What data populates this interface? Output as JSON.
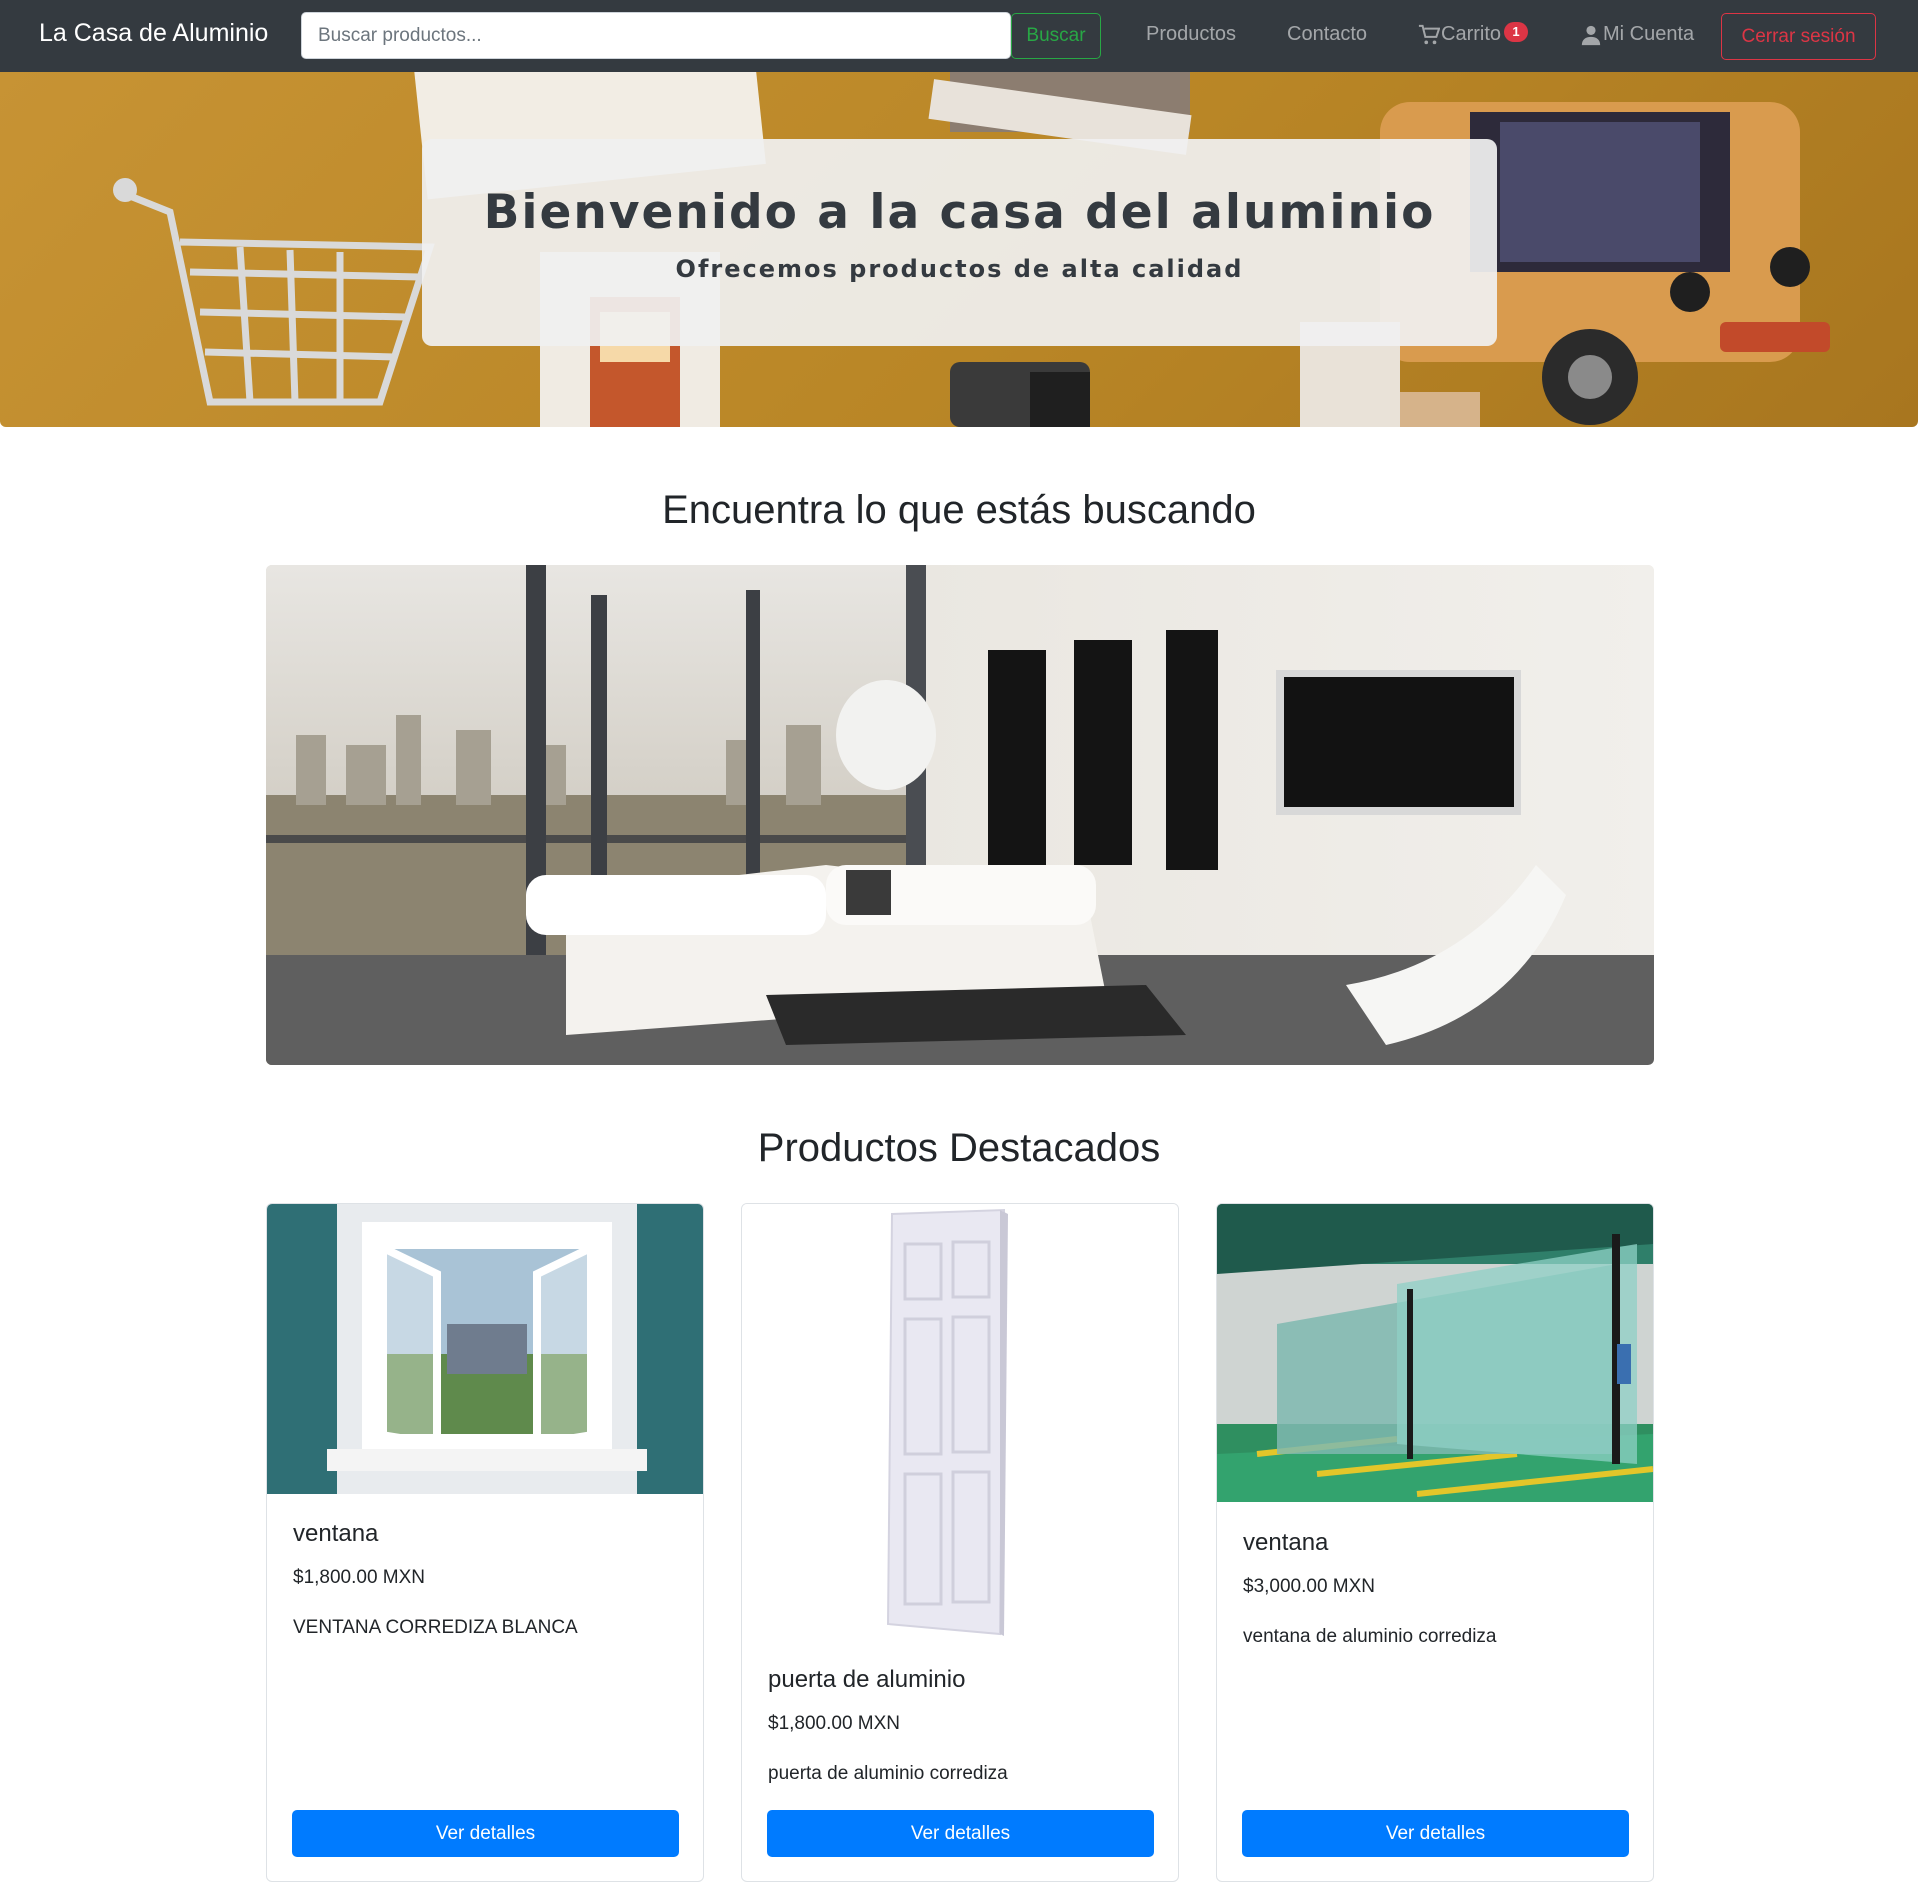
{
  "navbar": {
    "brand": "La Casa de Aluminio",
    "search_placeholder": "Buscar productos...",
    "search_button": "Buscar",
    "links": {
      "products": "Productos",
      "contact": "Contacto",
      "cart": "Carrito",
      "cart_count": "1",
      "account": "Mi Cuenta"
    },
    "logout_button": "Cerrar sesión",
    "icons": {
      "cart": "cart-icon",
      "account": "user-icon"
    }
  },
  "hero": {
    "title": "Bienvenido a la casa del aluminio",
    "subtitle": "Ofrecemos productos de alta calidad"
  },
  "find_section": {
    "title": "Encuentra lo que estás buscando"
  },
  "featured": {
    "title": "Productos Destacados",
    "products": [
      {
        "name": "ventana",
        "price": "$1,800.00 MXN",
        "description": "VENTANA CORREDIZA BLANCA",
        "button": "Ver detalles"
      },
      {
        "name": "puerta de aluminio",
        "price": "$1,800.00 MXN",
        "description": "puerta de aluminio corrediza",
        "button": "Ver detalles"
      },
      {
        "name": "ventana",
        "price": "$3,000.00 MXN",
        "description": "ventana de aluminio corrediza",
        "button": "Ver detalles"
      }
    ]
  },
  "colors": {
    "navbar_bg": "#343a40",
    "success": "#28a745",
    "danger": "#dc3545",
    "primary": "#007bff",
    "hero_bg": "#c79334"
  }
}
